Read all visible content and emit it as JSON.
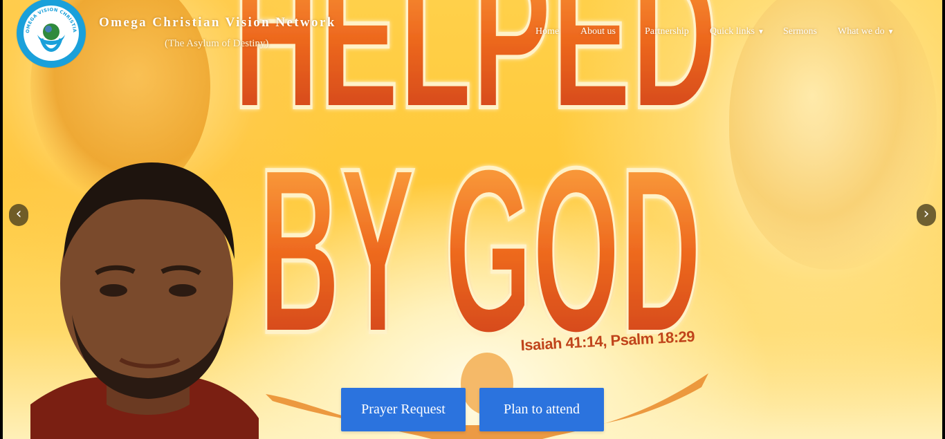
{
  "site": {
    "title": "Omega Christian Vision Network",
    "tagline": "(The Asylum of Destiny)",
    "logo_text": "OMEGA VISION CHRISTIAN NETWORK"
  },
  "nav": {
    "items": [
      {
        "label": "Home",
        "dropdown": false
      },
      {
        "label": "About us",
        "dropdown": false
      },
      {
        "label": "Partnership",
        "dropdown": false
      },
      {
        "label": "Quick links",
        "dropdown": true
      },
      {
        "label": "Sermons",
        "dropdown": false
      },
      {
        "label": "What we do",
        "dropdown": true
      }
    ]
  },
  "slider": {
    "headline_line1": "HELPED",
    "headline_line2": "BY GOD",
    "scripture": "Isaiah 41:14, Psalm 18:29",
    "prev_glyph": "‹",
    "next_glyph": "›"
  },
  "cta": {
    "prayer_label": "Prayer Request",
    "attend_label": "Plan to attend"
  },
  "colors": {
    "accent_blue": "#2b73de",
    "logo_blue": "#1aa0da",
    "headline_orange": "#e2561b",
    "background_yellow": "#ffc93a"
  }
}
